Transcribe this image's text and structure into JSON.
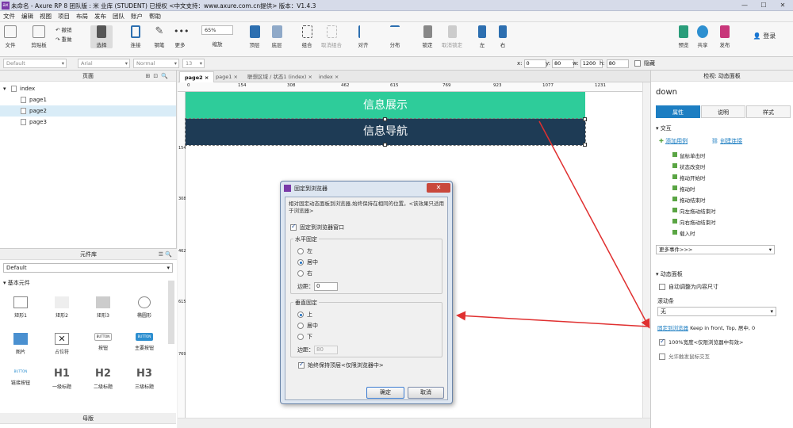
{
  "window": {
    "title": "未命名 - Axure RP 8 团队版 : 米 业库 (STUDENT) 已授权     <中文支持：www.axure.com.cn提供> 版本：V1.4.3",
    "logo": "ax"
  },
  "menu": [
    "文件",
    "编辑",
    "视图",
    "项目",
    "布局",
    "发布",
    "团队",
    "账户",
    "帮助"
  ],
  "toolbar": {
    "file": "文件",
    "clipboard": "剪贴板",
    "undo": "撤销",
    "redo": "重做",
    "select": "选择",
    "connect": "连接",
    "pen": "钢笔",
    "more": "更多",
    "zoom": "65%",
    "zoom_label": "缩放",
    "top": "顶层",
    "bottom": "底层",
    "group": "组合",
    "ungroup": "取消组合",
    "align": "对齐",
    "distribute": "分布",
    "lock": "锁定",
    "unlock": "取消锁定",
    "left": "左",
    "right": "右",
    "preview": "预览",
    "share": "共享",
    "publish": "发布",
    "login": "登录"
  },
  "format": {
    "style": "Default",
    "font": "Arial",
    "weight": "Normal",
    "size": "13",
    "x_label": "x:",
    "x": "0",
    "y_label": "y:",
    "y": "80",
    "w_label": "w:",
    "w": "1200",
    "h_label": "h:",
    "h": "80",
    "hidden": "隐藏"
  },
  "pages": {
    "title": "页面",
    "items": [
      {
        "name": "index",
        "level": 0
      },
      {
        "name": "page1",
        "level": 1
      },
      {
        "name": "page2",
        "level": 1,
        "selected": true
      },
      {
        "name": "page3",
        "level": 1
      }
    ]
  },
  "library": {
    "title": "元件库",
    "selected": "Default",
    "section": "基本元件",
    "widgets": [
      "矩形1",
      "矩形2",
      "矩形3",
      "椭圆形",
      "图片",
      "占位符",
      "按钮",
      "主要按钮",
      "链接按钮",
      "一级标题",
      "二级标题",
      "三级标题"
    ],
    "masters": "母版"
  },
  "tabs": [
    "page2",
    "page1",
    "联想区域 / 状态1 (index)",
    "index"
  ],
  "ruler": {
    "h": [
      "0",
      "154",
      "308",
      "462",
      "615",
      "769",
      "923",
      "1077",
      "1231"
    ],
    "v": [
      "154",
      "308",
      "462",
      "615",
      "769"
    ]
  },
  "canvas": {
    "bar1": "信息展示",
    "bar1_color": "#2ecc9a",
    "bar2": "信息导航",
    "bar2_color": "#1e3b55"
  },
  "inspector": {
    "header": "检视: 动态面板",
    "name": "down",
    "tabs": [
      "属性",
      "说明",
      "样式"
    ],
    "interaction": "交互",
    "add_case": "添加用例",
    "create_link": "创建连接",
    "events": [
      "鼠标单击时",
      "状态改变时",
      "拖动开始时",
      "拖动时",
      "拖动结束时",
      "向左拖动结束时",
      "向右拖动结束时",
      "载入时"
    ],
    "more_events": "更多事件>>>",
    "panel_section": "动态面板",
    "autofit": "自动调整为内容尺寸",
    "scrollbar_label": "滚动条",
    "scrollbar_value": "无",
    "pin_link": "固定到浏览器",
    "pin_status": "Keep in front, Top, 居中, 0",
    "full_width": "100%宽度<仅限浏览器中有效>",
    "partial": "允许触发鼠标交互"
  },
  "dialog": {
    "title": "固定到浏览器",
    "desc": "相对固定动态面板到浏览器,始终保持在相同的位置。<该效果只适用于浏览器>",
    "pin_checkbox": "固定到浏览器窗口",
    "h_group": "水平固定",
    "h_options": [
      "左",
      "居中",
      "右"
    ],
    "h_selected": "居中",
    "h_margin_label": "边距：",
    "h_margin": "0",
    "v_group": "垂直固定",
    "v_options": [
      "上",
      "居中",
      "下"
    ],
    "v_selected": "上",
    "v_margin_label": "边距：",
    "v_margin": "80",
    "front_checkbox": "始终保持顶层<仅限浏览器中>",
    "ok": "确定",
    "cancel": "取消"
  },
  "accent": "#1d7ec2",
  "arrow_color": "#e03030"
}
